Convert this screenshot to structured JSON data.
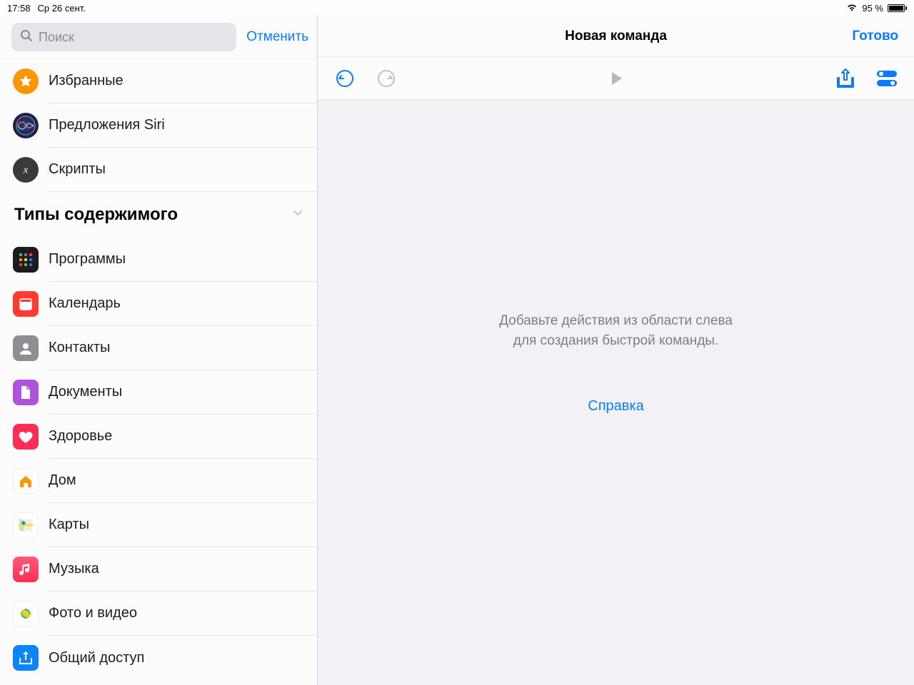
{
  "status": {
    "time": "17:58",
    "date": "Ср 26 сент.",
    "battery_pct": "95 %"
  },
  "search": {
    "placeholder": "Поиск",
    "cancel": "Отменить"
  },
  "top_items": [
    {
      "key": "favorites",
      "label": "Избранные"
    },
    {
      "key": "siri",
      "label": "Предложения Siri"
    },
    {
      "key": "scripts",
      "label": "Скрипты"
    }
  ],
  "section_title": "Типы содержимого",
  "content_items": [
    {
      "key": "apps",
      "label": "Программы"
    },
    {
      "key": "calendar",
      "label": "Календарь"
    },
    {
      "key": "contacts",
      "label": "Контакты"
    },
    {
      "key": "documents",
      "label": "Документы"
    },
    {
      "key": "health",
      "label": "Здоровье"
    },
    {
      "key": "home",
      "label": "Дом"
    },
    {
      "key": "maps",
      "label": "Карты"
    },
    {
      "key": "music",
      "label": "Музыка"
    },
    {
      "key": "photos",
      "label": "Фото и видео"
    },
    {
      "key": "sharing",
      "label": "Общий доступ"
    }
  ],
  "right": {
    "title": "Новая команда",
    "done": "Готово",
    "empty_text": "Добавьте действия из области слева для создания быстрой команды.",
    "help": "Справка"
  }
}
